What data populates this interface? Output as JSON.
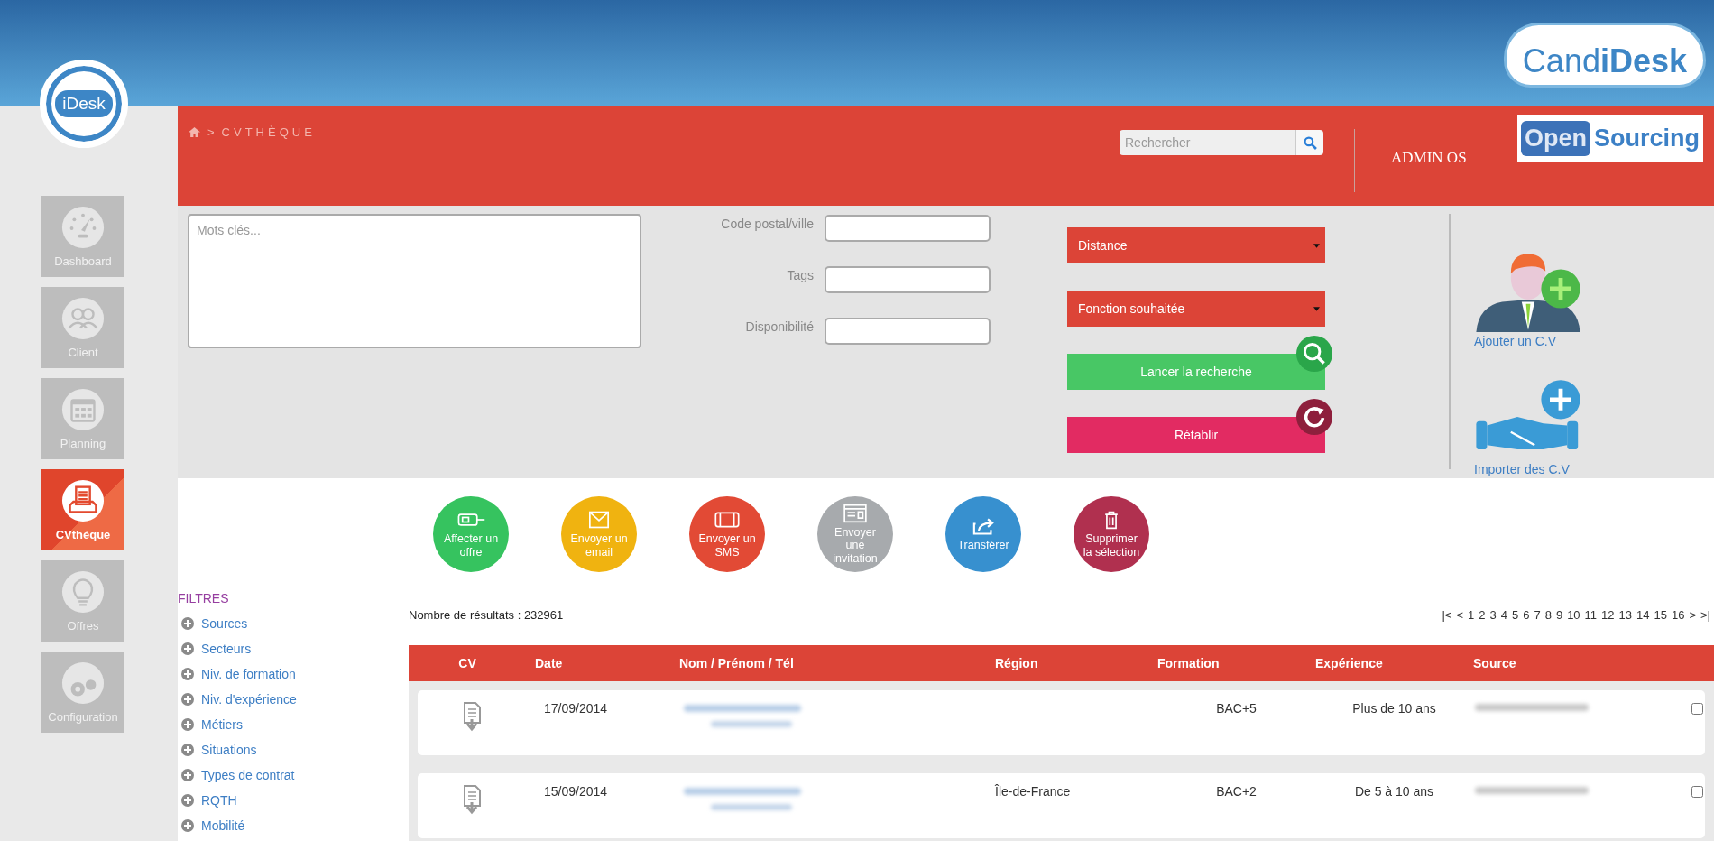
{
  "brand": {
    "logo_parts": [
      "Cand",
      "iDesk"
    ],
    "side_logo": "iDesk"
  },
  "sidebar": {
    "items": [
      {
        "label": "Dashboard",
        "selected": false
      },
      {
        "label": "Client",
        "selected": false
      },
      {
        "label": "Planning",
        "selected": false
      },
      {
        "label": "CVthèque",
        "selected": true
      },
      {
        "label": "Offres",
        "selected": false
      },
      {
        "label": "Configuration",
        "selected": false
      }
    ]
  },
  "header": {
    "separator": ">",
    "breadcrumb": "CVTHÈQUE",
    "search": {
      "placeholder": "Rechercher"
    },
    "user": "ADMIN OS",
    "partner_logo": [
      "Open",
      "Sourcing"
    ]
  },
  "search_form": {
    "keywords": {
      "placeholder": "Mots clés..."
    },
    "fields": [
      {
        "label": "Code postal/ville"
      },
      {
        "label": "Tags"
      },
      {
        "label": "Disponibilité"
      }
    ],
    "selects": [
      "Distance",
      "Fonction souhaitée"
    ],
    "buttons": [
      {
        "label": "Lancer la recherche",
        "kind": "search"
      },
      {
        "label": "Rétablir",
        "kind": "reset"
      }
    ],
    "side_links": [
      "Ajouter un C.V",
      "Importer des C.V"
    ]
  },
  "actions": [
    {
      "label": "Affecter un offre",
      "color": "#36c35f"
    },
    {
      "label": "Envoyer un email",
      "color": "#f0b310"
    },
    {
      "label": "Envoyer un SMS",
      "color": "#e24a35"
    },
    {
      "label": "Envoyer une invitation",
      "color": "#a7aaad"
    },
    {
      "label": "Transférer",
      "color": "#3790cf"
    },
    {
      "label": "Supprimer la sélection",
      "color": "#b0304f"
    }
  ],
  "filters": {
    "title": "FILTRES",
    "items": [
      "Sources",
      "Secteurs",
      "Niv. de formation",
      "Niv. d'expérience",
      "Métiers",
      "Situations",
      "Types de contrat",
      "RQTH",
      "Mobilité"
    ]
  },
  "results": {
    "count": "Nombre de résultats : 232961",
    "pagination": [
      "|<",
      "<",
      "1",
      "2",
      "3",
      "4",
      "5",
      "6",
      "7",
      "8",
      "9",
      "10",
      "11",
      "12",
      "13",
      "14",
      "15",
      "16",
      ">",
      ">|"
    ],
    "columns": [
      "CV",
      "Date",
      "Nom / Prénom / Tél",
      "Région",
      "Formation",
      "Expérience",
      "Source"
    ],
    "rows": [
      {
        "date": "17/09/2014",
        "region": "",
        "formation": "BAC+5",
        "experience": "Plus de 10 ans",
        "checked": false
      },
      {
        "date": "15/09/2014",
        "region": "Île-de-France",
        "formation": "BAC+2",
        "experience": "De 5 à 10 ans",
        "checked": false
      }
    ]
  }
}
